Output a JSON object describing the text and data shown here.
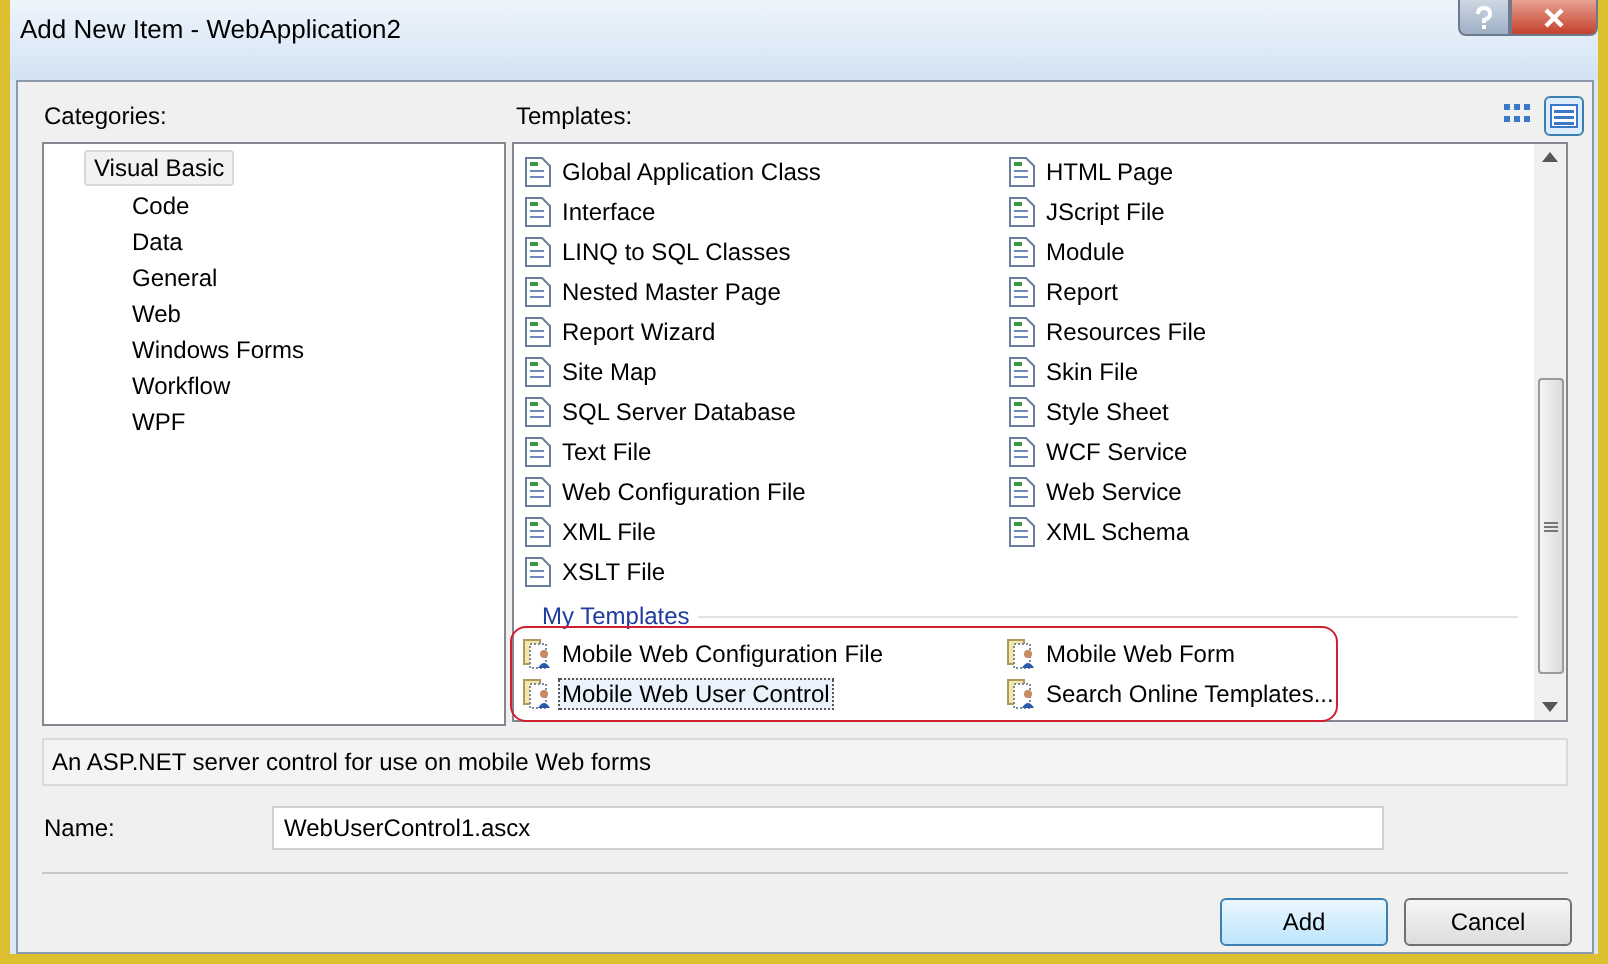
{
  "window": {
    "title": "Add New Item - WebApplication2"
  },
  "categories": {
    "label": "Categories:",
    "items": [
      {
        "label": "Visual Basic",
        "selected": true,
        "children": [
          {
            "label": "Code",
            "selected": false
          },
          {
            "label": "Data",
            "selected": false
          },
          {
            "label": "General",
            "selected": false
          },
          {
            "label": "Web",
            "selected": false
          },
          {
            "label": "Windows Forms",
            "selected": false
          },
          {
            "label": "Workflow",
            "selected": false
          },
          {
            "label": "WPF",
            "selected": false
          }
        ]
      }
    ]
  },
  "templates": {
    "label": "Templates:",
    "views": [
      {
        "kind": "large",
        "selected": false
      },
      {
        "kind": "small",
        "selected": true
      }
    ],
    "items": [
      {
        "label": "Global Application Class",
        "selected": false
      },
      {
        "label": "HTML Page",
        "selected": false
      },
      {
        "label": "Interface",
        "selected": false
      },
      {
        "label": "JScript File",
        "selected": false
      },
      {
        "label": "LINQ to SQL Classes",
        "selected": false
      },
      {
        "label": "Module",
        "selected": false
      },
      {
        "label": "Nested Master Page",
        "selected": false
      },
      {
        "label": "Report",
        "selected": false
      },
      {
        "label": "Report Wizard",
        "selected": false
      },
      {
        "label": "Resources File",
        "selected": false
      },
      {
        "label": "Site Map",
        "selected": false
      },
      {
        "label": "Skin File",
        "selected": false
      },
      {
        "label": "SQL Server Database",
        "selected": false
      },
      {
        "label": "Style Sheet",
        "selected": false
      },
      {
        "label": "Text File",
        "selected": false
      },
      {
        "label": "WCF Service",
        "selected": false
      },
      {
        "label": "Web Configuration File",
        "selected": false
      },
      {
        "label": "Web Service",
        "selected": false
      },
      {
        "label": "XML File",
        "selected": false
      },
      {
        "label": "XML Schema",
        "selected": false
      },
      {
        "label": "XSLT File",
        "selected": false
      }
    ],
    "my_templates": {
      "heading": "My Templates",
      "items": [
        {
          "label": "Mobile Web Configuration File",
          "selected": false
        },
        {
          "label": "Mobile Web Form",
          "selected": false
        },
        {
          "label": "Mobile Web User Control",
          "selected": true
        },
        {
          "label": "Search Online Templates...",
          "selected": false
        }
      ]
    }
  },
  "description": "An ASP.NET server control for use on mobile Web forms",
  "name_field": {
    "label": "Name:",
    "value": "WebUserControl1.ascx"
  },
  "buttons": [
    {
      "label": "Add",
      "default": true
    },
    {
      "label": "Cancel",
      "default": false
    }
  ]
}
